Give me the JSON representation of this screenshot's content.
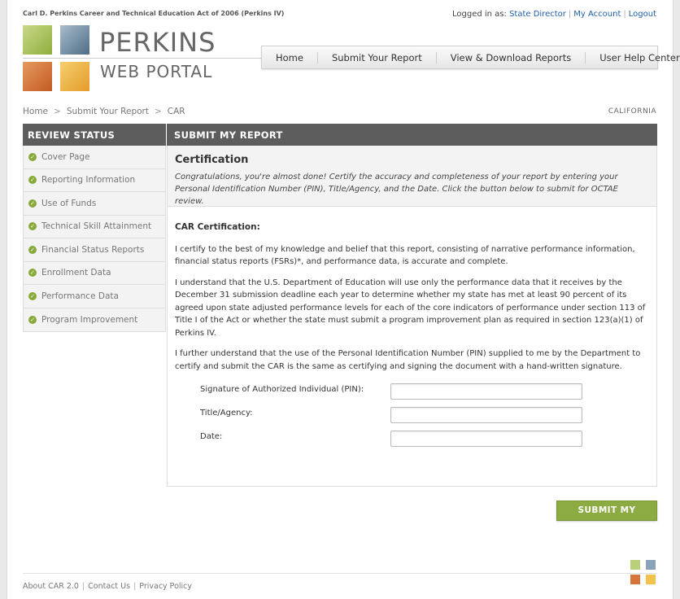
{
  "header": {
    "act_title": "Carl D. Perkins Career and Technical Education Act of 2006 (Perkins IV)",
    "logged_in_label": "Logged in as:",
    "user": "State Director",
    "my_account": "My Account",
    "logout": "Logout",
    "brand_line1": "PERKINS",
    "brand_line2": "WEB PORTAL"
  },
  "nav": {
    "items": [
      "Home",
      "Submit Your Report",
      "View & Download Reports",
      "User Help Center"
    ]
  },
  "breadcrumb": [
    "Home",
    "Submit Your Report",
    "CAR"
  ],
  "state": "CALIFORNIA",
  "sidebar": {
    "title": "REVIEW STATUS",
    "items": [
      "Cover Page",
      "Reporting Information",
      "Use of Funds",
      "Technical Skill Attainment",
      "Financial Status Reports",
      "Enrollment Data",
      "Performance Data",
      "Program Improvement"
    ]
  },
  "main": {
    "title": "SUBMIT MY REPORT",
    "cert_title": "Certification",
    "cert_message": "Congratulations, you're almost done! Certify the accuracy and completeness of your report by entering your Personal Identification Number (PIN), Title/Agency, and the Date. Click the button below to submit for OCTAE review.",
    "car_heading": "CAR Certification:",
    "para1": "I certify to the best of my knowledge and belief that this report, consisting of narrative performance information, financial status reports (FSRs)*, and performance data, is accurate and complete.",
    "para2": "I understand that the U.S. Department of Education will use only the performance data that it receives by the December 31 submission deadline each year to determine whether my state has met at least 90 percent of its agreed upon state adjusted performance levels for each of the core indicators of performance under section 113 of Title I of the Act or whether the state must submit a program improvement plan as required in section 123(a)(1) of Perkins IV.",
    "para3": "I further understand that the use of the Personal Identification Number (PIN) supplied to me by the Department to certify and submit the CAR is the same as certifying and signing the document with a hand-written signature.",
    "form": {
      "pin_label": "Signature of Authorized Individual (PIN):",
      "pin_value": "",
      "title_label": "Title/Agency:",
      "title_value": "",
      "date_label": "Date:",
      "date_value": ""
    },
    "submit_label": "SUBMIT MY REPORT"
  },
  "footer": {
    "about": "About CAR 2.0",
    "contact": "Contact Us",
    "privacy": "Privacy Policy"
  },
  "colors": {
    "accent_green": "#8cab43",
    "header_gray": "#5d5d5d",
    "link_blue": "#1f5fa8",
    "tile_green": "#b9cf7a",
    "tile_blue": "#8aa3b8",
    "tile_orange": "#d7743a",
    "tile_yellow": "#f2c14e"
  }
}
